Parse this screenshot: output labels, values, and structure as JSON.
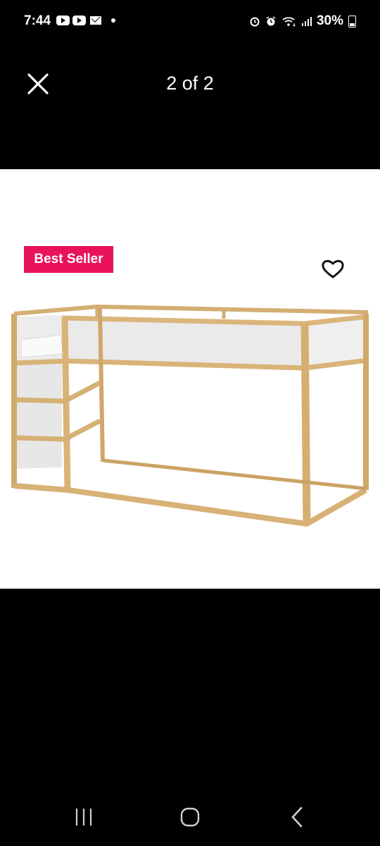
{
  "status_bar": {
    "time": "7:44",
    "battery_percent": "30%",
    "icons": [
      "youtube-icon",
      "youtube-icon",
      "mail-icon",
      "notification-dot",
      "alarm-icon",
      "wifi-icon",
      "signal-icon",
      "battery-icon"
    ]
  },
  "viewer": {
    "page_counter": "2 of 2",
    "close_icon": "close-icon"
  },
  "product": {
    "badge_label": "Best Seller",
    "badge_color": "#e8135a",
    "favorite_icon": "heart-outline-icon",
    "image": "loft-bed-wooden-frame"
  },
  "navigation_bar": {
    "buttons": [
      "recent-apps-icon",
      "home-icon",
      "back-icon"
    ]
  }
}
